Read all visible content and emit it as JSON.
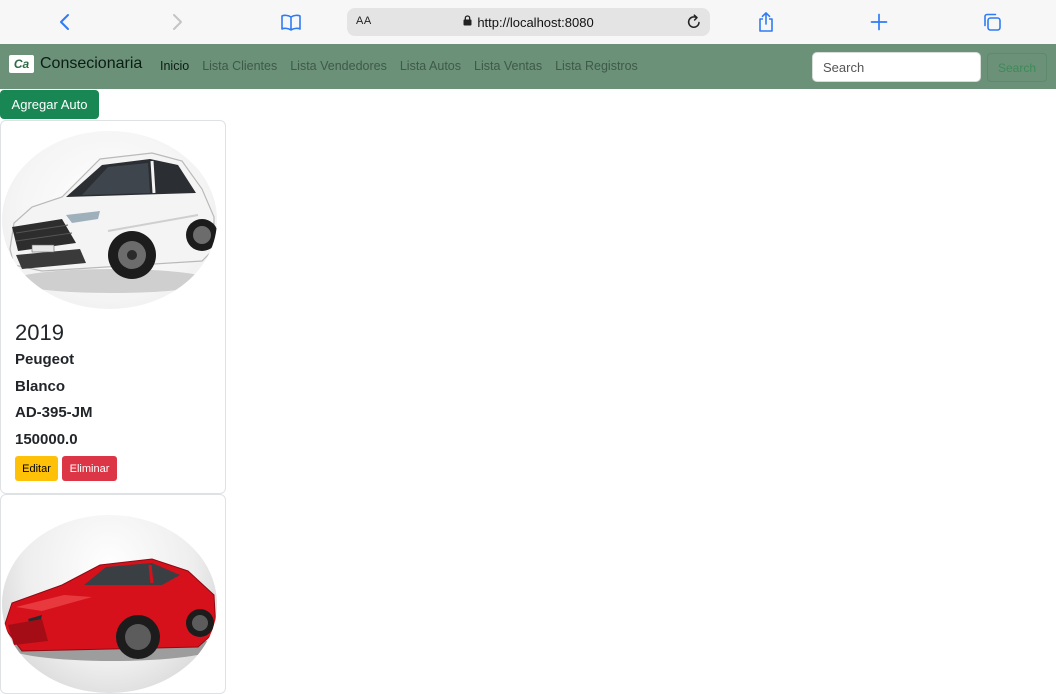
{
  "browser": {
    "text_size_label": "AA",
    "url": "http://localhost:8080",
    "icons": [
      "back-icon",
      "forward-icon",
      "bookmarks-icon",
      "lock-icon",
      "reload-icon",
      "share-icon",
      "new-tab-icon",
      "tabs-icon"
    ]
  },
  "navbar": {
    "brand_logo": "Ca",
    "brand_name": "Consecionaria",
    "links": [
      "Inicio",
      "Lista Clientes",
      "Lista Vendedores",
      "Lista Autos",
      "Lista Ventas",
      "Lista Registros"
    ],
    "search_placeholder": "Search",
    "search_button": "Search",
    "colors": {
      "background": "#6b9179",
      "search_button": "#3e8a58"
    }
  },
  "page": {
    "add_button": "Agregar Auto",
    "cars": [
      {
        "year": "2019",
        "brand": "Peugeot",
        "color": "Blanco",
        "plate": "AD-395-JM",
        "price": "150000.0",
        "edit_label": "Editar",
        "delete_label": "Eliminar",
        "image": "white-suv-photo"
      },
      {
        "image": "red-sports-car-photo"
      }
    ],
    "colors": {
      "add": "#198754",
      "edit": "#ffc107",
      "delete": "#dc3545"
    }
  }
}
